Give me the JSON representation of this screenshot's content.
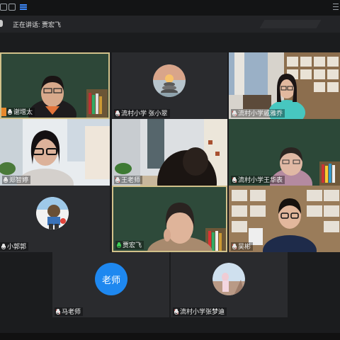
{
  "speaking": {
    "text": "正在讲话: 贾宏飞"
  },
  "tiles": [
    {
      "name": "谢增太"
    },
    {
      "name": "流村小学 张小翠"
    },
    {
      "name": "流村小学戚雅乔"
    },
    {
      "name": "郑智婷"
    },
    {
      "name": "王老师"
    },
    {
      "name": "流村小学王华表"
    },
    {
      "name": "小郭郭"
    },
    {
      "name": "贾宏飞"
    },
    {
      "name": "吴彬"
    },
    {
      "name": "马老师",
      "avatar_text": "老师"
    },
    {
      "name": "流村小学张梦迪"
    }
  ],
  "colors": {
    "active_border": "#d1c18a",
    "avatar_blue": "#1e88f0",
    "active_mic": "#3ecf55"
  }
}
